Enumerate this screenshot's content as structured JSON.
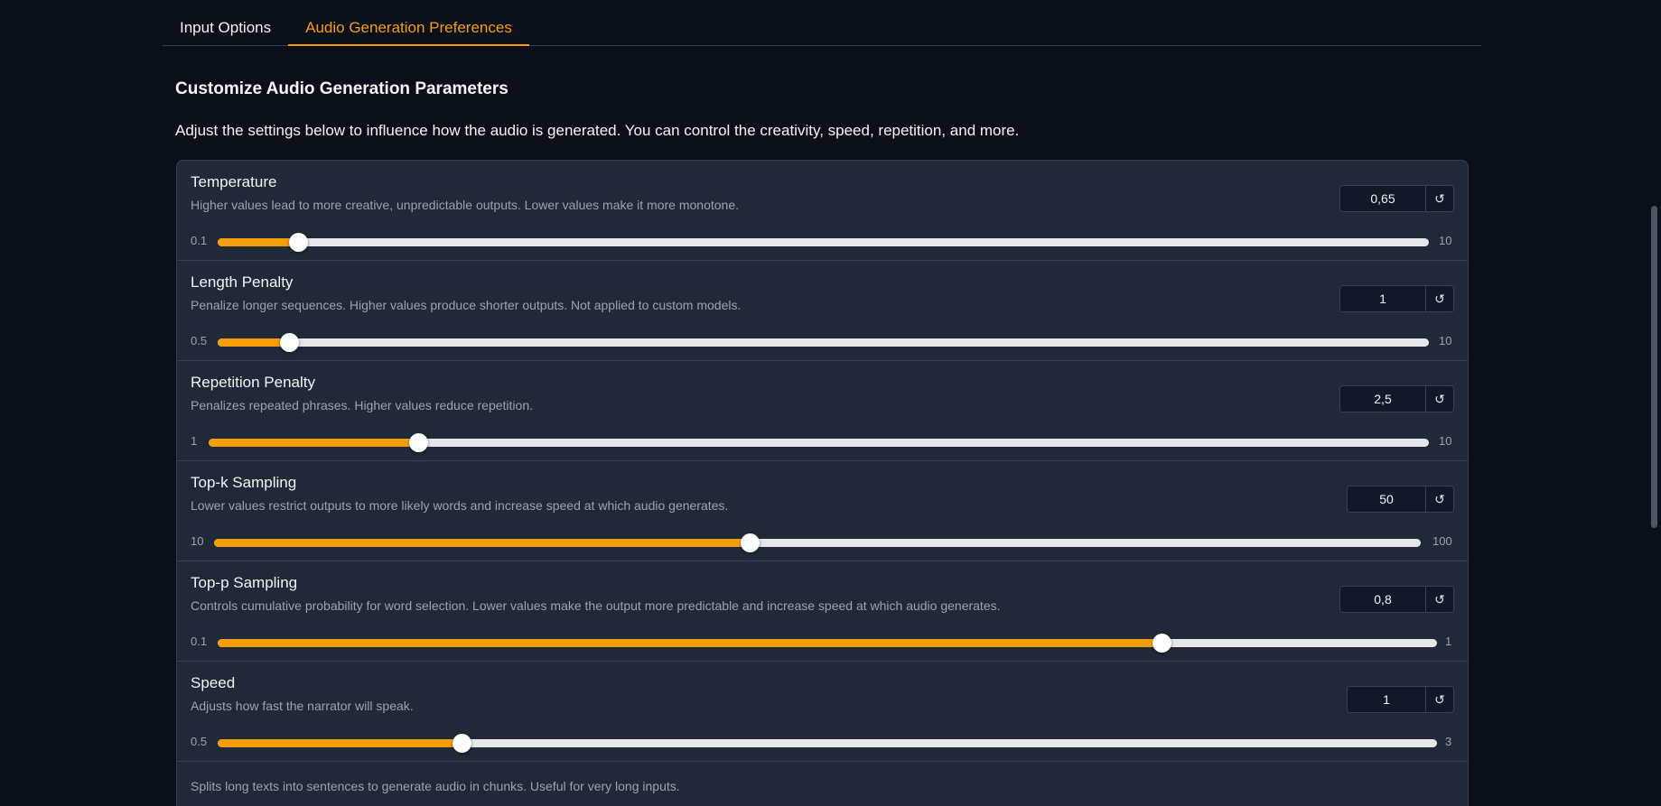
{
  "tabs": [
    {
      "label": "Input Options",
      "active": false
    },
    {
      "label": "Audio Generation Preferences",
      "active": true
    }
  ],
  "section": {
    "title": "Customize Audio Generation Parameters",
    "description": "Adjust the settings below to influence how the audio is generated. You can control the creativity, speed, repetition, and more."
  },
  "sliders": [
    {
      "label": "Temperature",
      "info": "Higher values lead to more creative, unpredictable outputs. Lower values make it more monotone.",
      "value": "0,65",
      "min": "0.1",
      "max": "10",
      "fraction": 0.066
    },
    {
      "label": "Length Penalty",
      "info": "Penalize longer sequences. Higher values produce shorter outputs. Not applied to custom models.",
      "value": "1",
      "min": "0.5",
      "max": "10",
      "fraction": 0.059
    },
    {
      "label": "Repetition Penalty",
      "info": "Penalizes repeated phrases. Higher values reduce repetition.",
      "value": "2,5",
      "min": "1",
      "max": "10",
      "fraction": 0.172
    },
    {
      "label": "Top-k Sampling",
      "info": "Lower values restrict outputs to more likely words and increase speed at which audio generates.",
      "value": "50",
      "min": "10",
      "max": "100",
      "fraction": 0.444
    },
    {
      "label": "Top-p Sampling",
      "info": "Controls cumulative probability for word selection. Lower values make the output more predictable and increase speed at which audio generates.",
      "value": "0,8",
      "min": "0.1",
      "max": "1",
      "fraction": 0.774
    },
    {
      "label": "Speed",
      "info": "Adjusts how fast the narrator will speak.",
      "value": "1",
      "min": "0.5",
      "max": "3",
      "fraction": 0.2
    }
  ],
  "split_info": "Splits long texts into sentences to generate audio in chunks. Useful for very long inputs.",
  "colors": {
    "accent": "#f59e0b",
    "panel": "#1f2937",
    "background": "#0b0f19"
  },
  "icons": {
    "reset": "reset-icon"
  }
}
